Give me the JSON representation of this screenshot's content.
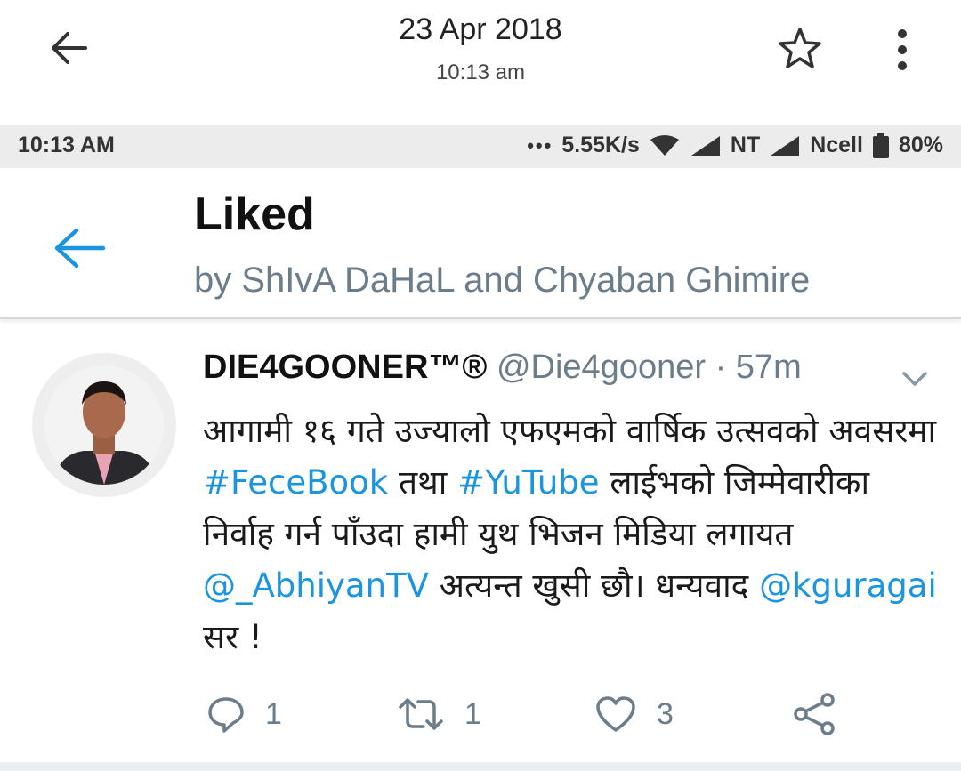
{
  "gallery_header": {
    "date": "23 Apr 2018",
    "time": "10:13 am",
    "icons": [
      "back-arrow-icon",
      "star-icon",
      "more-vert-icon"
    ]
  },
  "status_bar": {
    "time": "10:13 AM",
    "dots": "•••",
    "speed": "5.55K/s",
    "carrier1": "NT",
    "carrier2": "Ncell",
    "battery": "80%"
  },
  "app_bar": {
    "title": "Liked",
    "subtitle": "by ShIvA DaHaL and Chyaban Ghimire"
  },
  "tweet": {
    "name": "DIE4GOONER™®",
    "handle": "@Die4gooner",
    "separator": "·",
    "time": "57m",
    "body_parts": {
      "p1": "आगामी १६ गते उज्यालो एफएमको वार्षिक उत्सवको अवसरमा ",
      "l1": "#FeceBook",
      "p2": " तथा ",
      "l2": "#YuTube",
      "p3": " लाईभको जिम्मेवारीका निर्वाह गर्न पाँउदा हामी युथ भिजन मिडिया लगायत  ",
      "l3": "@_AbhiyanTV",
      "p4": " अत्यन्त खुसी छौ। धन्यवाद ",
      "l4": "@kguragai",
      "p5": " सर !"
    },
    "actions": {
      "reply_count": "1",
      "retweet_count": "1",
      "like_count": "3"
    }
  },
  "colors": {
    "link": "#1b95e0",
    "secondary_text": "#6b7c8a",
    "status_bar_bg": "#ececec"
  }
}
